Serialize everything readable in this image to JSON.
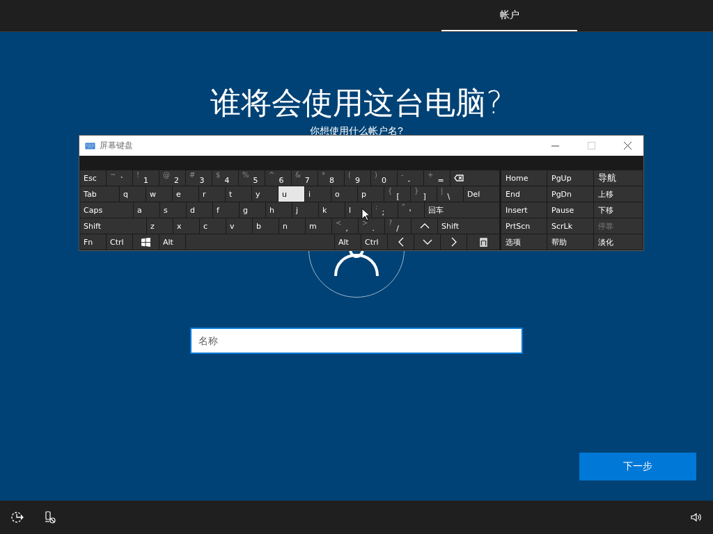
{
  "top_bar": {
    "tabs": [
      {
        "label": "帐户",
        "selected": true
      }
    ]
  },
  "heading": "谁将会使用这台电脑?",
  "subtitle": "你想使用什么帐户名?",
  "name_field": {
    "placeholder": "名称"
  },
  "next_button": "下一步",
  "osk": {
    "title": "屏幕键盘",
    "rows": [
      [
        {
          "kind": "key",
          "label": "Esc",
          "highlighted": false
        },
        {
          "kind": "char",
          "shift": "~",
          "label": "`",
          "highlighted": false
        },
        {
          "kind": "char",
          "shift": "!",
          "label": "1",
          "highlighted": false
        },
        {
          "kind": "char",
          "shift": "@",
          "label": "2",
          "highlighted": false
        },
        {
          "kind": "char",
          "shift": "#",
          "label": "3",
          "highlighted": false
        },
        {
          "kind": "char",
          "shift": "$",
          "label": "4",
          "highlighted": false
        },
        {
          "kind": "char",
          "shift": "%",
          "label": "5",
          "highlighted": false
        },
        {
          "kind": "char",
          "shift": "^",
          "label": "6",
          "highlighted": false
        },
        {
          "kind": "char",
          "shift": "&",
          "label": "7",
          "highlighted": false
        },
        {
          "kind": "char",
          "shift": "*",
          "label": "8",
          "highlighted": false
        },
        {
          "kind": "char",
          "shift": "(",
          "label": "9",
          "highlighted": false
        },
        {
          "kind": "char",
          "shift": ")",
          "label": "0",
          "highlighted": false
        },
        {
          "kind": "char",
          "shift": "-",
          "label": "-",
          "highlighted": false
        },
        {
          "kind": "char",
          "shift": "+",
          "label": "=",
          "highlighted": false
        },
        {
          "kind": "backspace",
          "highlighted": false
        }
      ],
      [
        {
          "kind": "tab",
          "label": "Tab",
          "highlighted": false
        },
        {
          "kind": "key",
          "label": "q",
          "highlighted": false
        },
        {
          "kind": "key",
          "label": "w",
          "highlighted": false
        },
        {
          "kind": "key",
          "label": "e",
          "highlighted": false
        },
        {
          "kind": "key",
          "label": "r",
          "highlighted": false
        },
        {
          "kind": "key",
          "label": "t",
          "highlighted": false
        },
        {
          "kind": "key",
          "label": "y",
          "highlighted": false
        },
        {
          "kind": "key",
          "label": "u",
          "highlighted": true
        },
        {
          "kind": "key",
          "label": "i",
          "highlighted": false
        },
        {
          "kind": "key",
          "label": "o",
          "highlighted": false
        },
        {
          "kind": "key",
          "label": "p",
          "highlighted": false
        },
        {
          "kind": "char",
          "shift": "{",
          "label": "[",
          "highlighted": false
        },
        {
          "kind": "char",
          "shift": "}",
          "label": "]",
          "highlighted": false
        },
        {
          "kind": "char",
          "shift": "|",
          "label": "\\",
          "highlighted": false
        },
        {
          "kind": "key",
          "label": "Del",
          "highlighted": false
        }
      ],
      [
        {
          "kind": "caps",
          "label": "Caps",
          "highlighted": false
        },
        {
          "kind": "key",
          "label": "a",
          "highlighted": false
        },
        {
          "kind": "key",
          "label": "s",
          "highlighted": false
        },
        {
          "kind": "key",
          "label": "d",
          "highlighted": false
        },
        {
          "kind": "key",
          "label": "f",
          "highlighted": false
        },
        {
          "kind": "key",
          "label": "g",
          "highlighted": false
        },
        {
          "kind": "key",
          "label": "h",
          "highlighted": false
        },
        {
          "kind": "key",
          "label": "j",
          "highlighted": false
        },
        {
          "kind": "key",
          "label": "k",
          "highlighted": false
        },
        {
          "kind": "key",
          "label": "l",
          "highlighted": false
        },
        {
          "kind": "char",
          "shift": ":",
          "label": ";",
          "highlighted": false
        },
        {
          "kind": "char",
          "shift": "\"",
          "label": "'",
          "highlighted": false
        },
        {
          "kind": "key",
          "label": "回车",
          "highlighted": false
        }
      ],
      [
        {
          "kind": "shift",
          "label": "Shift",
          "highlighted": false
        },
        {
          "kind": "key",
          "label": "z",
          "highlighted": false
        },
        {
          "kind": "key",
          "label": "x",
          "highlighted": false
        },
        {
          "kind": "key",
          "label": "c",
          "highlighted": false
        },
        {
          "kind": "key",
          "label": "v",
          "highlighted": false
        },
        {
          "kind": "key",
          "label": "b",
          "highlighted": false
        },
        {
          "kind": "key",
          "label": "n",
          "highlighted": false
        },
        {
          "kind": "key",
          "label": "m",
          "highlighted": false
        },
        {
          "kind": "char",
          "shift": "<",
          "label": ",",
          "highlighted": false
        },
        {
          "kind": "char",
          "shift": ">",
          "label": ".",
          "highlighted": false
        },
        {
          "kind": "char",
          "shift": "?",
          "label": "/",
          "highlighted": false
        },
        {
          "kind": "up",
          "highlighted": false
        },
        {
          "kind": "key",
          "label": "Shift",
          "highlighted": false
        }
      ],
      [
        {
          "kind": "key",
          "label": "Fn",
          "highlighted": false
        },
        {
          "kind": "key",
          "label": "Ctrl",
          "highlighted": false
        },
        {
          "kind": "windows",
          "highlighted": false
        },
        {
          "kind": "key",
          "label": "Alt",
          "highlighted": false
        },
        {
          "kind": "space",
          "highlighted": false
        },
        {
          "kind": "key",
          "label": "Alt",
          "highlighted": false
        },
        {
          "kind": "key",
          "label": "Ctrl",
          "highlighted": false
        },
        {
          "kind": "left",
          "highlighted": false
        },
        {
          "kind": "down",
          "highlighted": false
        },
        {
          "kind": "right",
          "highlighted": false
        },
        {
          "kind": "menu",
          "highlighted": false
        }
      ]
    ],
    "nav": [
      [
        {
          "label": "Home",
          "disabled": false
        },
        {
          "label": "PgUp",
          "disabled": false
        },
        {
          "label": "导航",
          "disabled": false
        }
      ],
      [
        {
          "label": "End",
          "disabled": false
        },
        {
          "label": "PgDn",
          "disabled": false
        },
        {
          "label": "上移",
          "disabled": false
        }
      ],
      [
        {
          "label": "Insert",
          "disabled": false
        },
        {
          "label": "Pause",
          "disabled": false
        },
        {
          "label": "下移",
          "disabled": false
        }
      ],
      [
        {
          "label": "PrtScn",
          "disabled": false
        },
        {
          "label": "ScrLk",
          "disabled": false
        },
        {
          "label": "停靠",
          "disabled": true
        }
      ],
      [
        {
          "label": "选项",
          "disabled": false
        },
        {
          "label": "帮助",
          "disabled": false
        },
        {
          "label": "淡化",
          "disabled": false
        }
      ]
    ]
  }
}
